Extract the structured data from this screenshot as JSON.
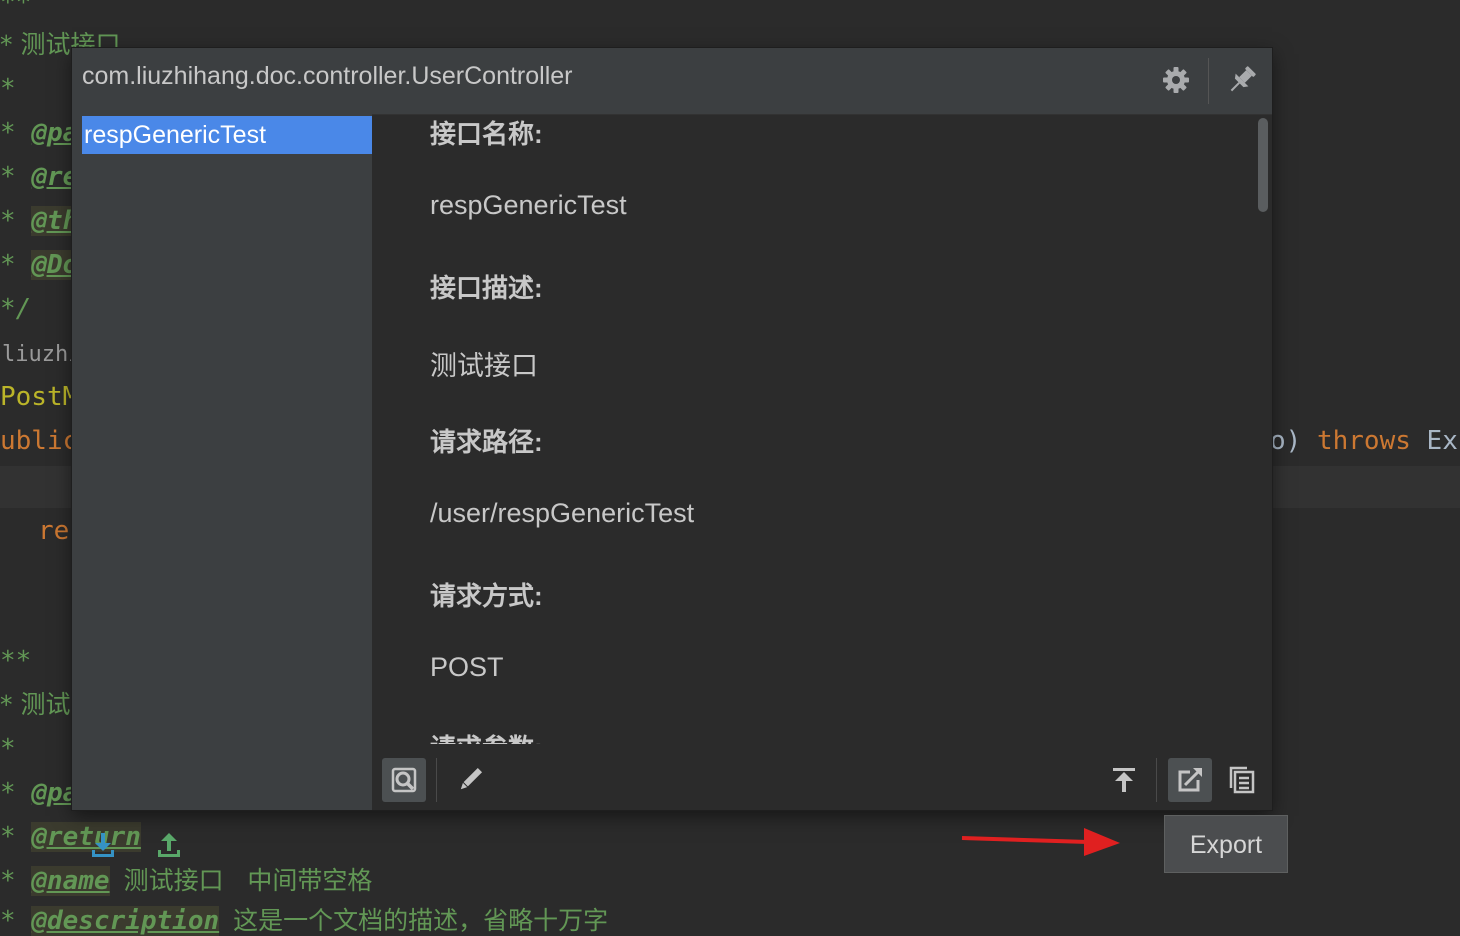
{
  "editor": {
    "lines": [
      {
        "text": "**"
      },
      {
        "text": "* 测试接口"
      },
      {
        "text": "*"
      },
      {
        "text": "@pa"
      },
      {
        "text": "@re"
      },
      {
        "text": "@th"
      },
      {
        "text": "@Do"
      },
      {
        "text": "*/"
      },
      {
        "text": "liuzhih"
      },
      {
        "text": "PostMa"
      },
      {
        "text": "ublic"
      },
      {
        "text": "o)"
      },
      {
        "text": "throws"
      },
      {
        "text": "Exc"
      },
      {
        "text": "re"
      },
      {
        "text": "**"
      },
      {
        "text": "* 测试"
      },
      {
        "text": "*"
      },
      {
        "text": "@pa"
      },
      {
        "text": "@return"
      },
      {
        "text": "@name"
      },
      {
        "text": "测试接口   中间带空格"
      },
      {
        "text": "@description"
      },
      {
        "text": "这是一个文档的描述，省略十万字"
      }
    ]
  },
  "popup": {
    "title": "com.liuzhihang.doc.controller.UserController",
    "header_icons": [
      "gear-icon",
      "pin-icon"
    ],
    "list": [
      {
        "label": "respGenericTest",
        "selected": true
      }
    ],
    "sidebar_icons": [
      "import-icon",
      "upload-icon"
    ],
    "doc": {
      "name_label": "接口名称:",
      "name_value": "respGenericTest",
      "desc_label": "接口描述:",
      "desc_value": "测试接口",
      "path_label": "请求路径:",
      "path_value": "/user/respGenericTest",
      "method_label": "请求方式:",
      "method_value": "POST",
      "params_label": "请求参数:"
    },
    "toolbar": {
      "left_icons": [
        "search-preview-icon",
        "edit-icon"
      ],
      "right_icons": [
        "pin-to-top-icon",
        "export-icon",
        "copy-icon"
      ]
    }
  },
  "tooltip": {
    "text": "Export"
  },
  "colors": {
    "accent": "#4a88e8",
    "arrow": "#e02020",
    "comment": "#629755",
    "keyword": "#cc7832"
  }
}
